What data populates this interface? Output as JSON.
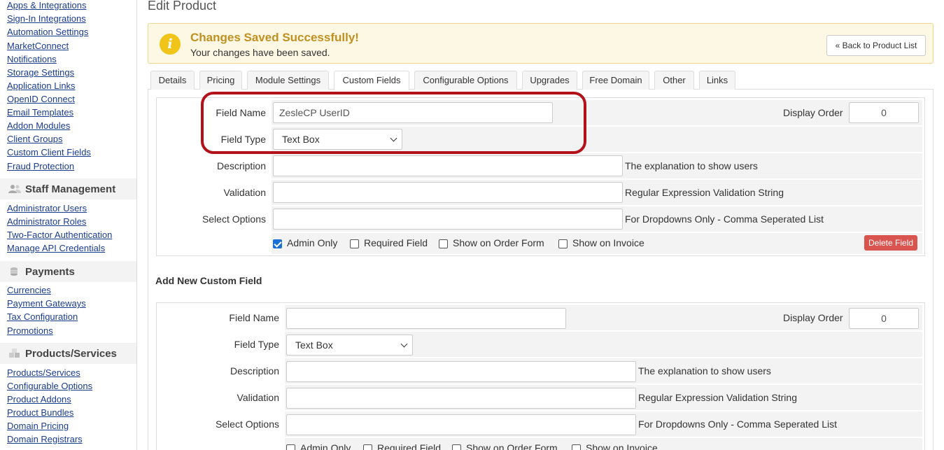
{
  "sidebar": {
    "links_top": [
      "Apps & Integrations",
      "Sign-In Integrations",
      "Automation Settings",
      "MarketConnect",
      "Notifications",
      "Storage Settings",
      "Application Links",
      "OpenID Connect",
      "Email Templates",
      "Addon Modules",
      "Client Groups",
      "Custom Client Fields",
      "Fraud Protection"
    ],
    "staff_heading": "Staff Management",
    "staff_links": [
      "Administrator Users",
      "Administrator Roles",
      "Two-Factor Authentication",
      "Manage API Credentials"
    ],
    "payments_heading": "Payments",
    "payments_links": [
      "Currencies",
      "Payment Gateways",
      "Tax Configuration",
      "Promotions"
    ],
    "products_heading": "Products/Services",
    "products_links": [
      "Products/Services",
      "Configurable Options",
      "Product Addons",
      "Product Bundles",
      "Domain Pricing",
      "Domain Registrars"
    ]
  },
  "page": {
    "title": "Edit Product"
  },
  "alert": {
    "title": "Changes Saved Successfully!",
    "text": "Your changes have been saved.",
    "back_button": "« Back to Product List"
  },
  "tabs": [
    "Details",
    "Pricing",
    "Module Settings",
    "Custom Fields",
    "Configurable Options",
    "Upgrades",
    "Free Domain",
    "Other",
    "Links"
  ],
  "active_tab": "Custom Fields",
  "existing_field": {
    "field_name_label": "Field Name",
    "field_name_value": "ZesleCP UserID",
    "display_order_label": "Display Order",
    "display_order_value": "0",
    "field_type_label": "Field Type",
    "field_type_value": "Text Box",
    "description_label": "Description",
    "description_hint": "The explanation to show users",
    "validation_label": "Validation",
    "validation_hint": "Regular Expression Validation String",
    "select_options_label": "Select Options",
    "select_options_hint": "For Dropdowns Only - Comma Seperated List",
    "admin_only": "Admin Only",
    "required_field": "Required Field",
    "show_on_order_form": "Show on Order Form",
    "show_on_invoice": "Show on Invoice",
    "admin_only_checked": true,
    "delete_button": "Delete Field"
  },
  "new_field_heading": "Add New Custom Field",
  "new_field": {
    "field_name_label": "Field Name",
    "field_name_value": "",
    "display_order_label": "Display Order",
    "display_order_value": "0",
    "field_type_label": "Field Type",
    "field_type_value": "Text Box",
    "description_label": "Description",
    "description_hint": "The explanation to show users",
    "validation_label": "Validation",
    "validation_hint": "Regular Expression Validation String",
    "select_options_label": "Select Options",
    "select_options_hint": "For Dropdowns Only - Comma Seperated List",
    "admin_only": "Admin Only",
    "required_field": "Required Field",
    "show_on_order_form": "Show on Order Form",
    "show_on_invoice": "Show on Invoice"
  },
  "colors": {
    "link": "#1a3c8f",
    "alert_bg": "#fcf8e3",
    "alert_title": "#c09020",
    "delete": "#d9534f",
    "highlight": "#b3121a",
    "checkbox": "#1a6fd6"
  }
}
